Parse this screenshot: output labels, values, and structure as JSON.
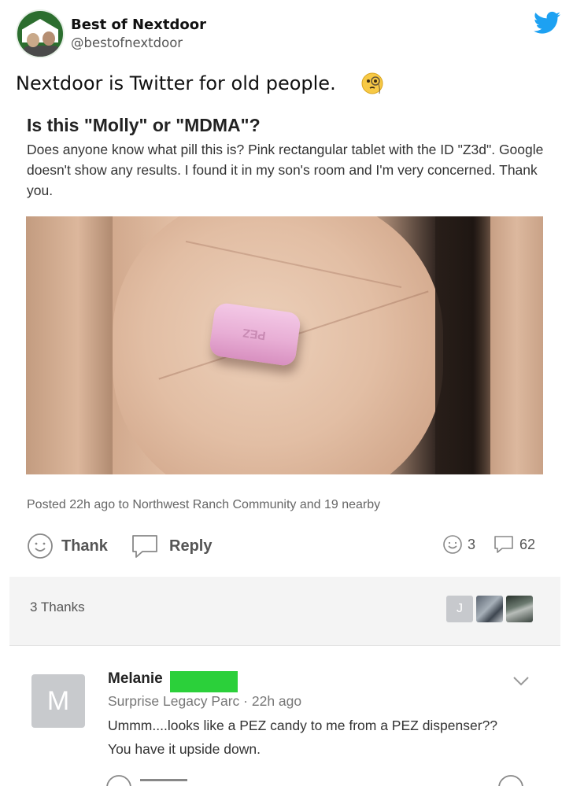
{
  "tweet": {
    "account_name": "Best of Nextdoor",
    "handle": "@bestofnextdoor",
    "text": "Nextdoor is Twitter for old people.",
    "emoji": "face-with-monocle",
    "brand_color": "#1DA1F2"
  },
  "post": {
    "title": "Is this \"Molly\" or \"MDMA\"?",
    "body": "Does anyone know what pill this is? Pink rectangular tablet with the ID \"Z3d\". Google doesn't show any results. I found it in my son's room and I'm very concerned. Thank you.",
    "pill_imprint": "PEZ",
    "meta": "Posted 22h ago to Northwest Ranch Community and 19 nearby"
  },
  "actions": {
    "thank_label": "Thank",
    "reply_label": "Reply",
    "thanks_count": "3",
    "replies_count": "62"
  },
  "thanks_bar": {
    "label": "3 Thanks",
    "avatars": [
      {
        "kind": "letter",
        "text": "J"
      },
      {
        "kind": "photo",
        "text": ""
      },
      {
        "kind": "photo",
        "text": ""
      }
    ]
  },
  "comment": {
    "avatar_letter": "M",
    "author": "Melanie",
    "meta": "Surprise Legacy Parc · 22h ago",
    "text": "Ummm....looks like a PEZ candy to me from a PEZ dispenser?? You have it upside down.",
    "redaction_color": "#2BD03A"
  }
}
